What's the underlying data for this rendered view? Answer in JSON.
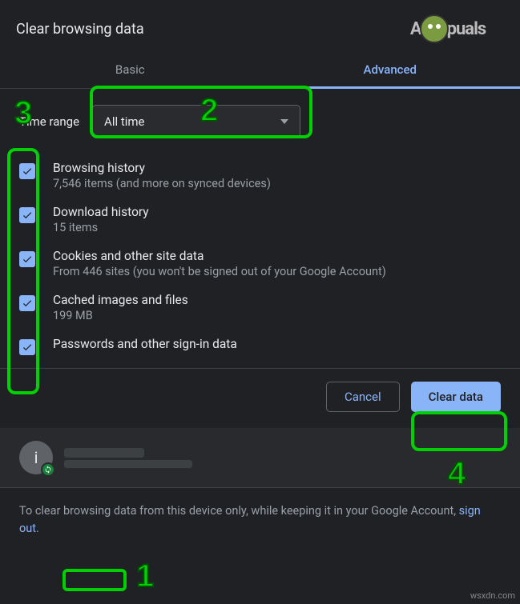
{
  "title": "Clear browsing data",
  "logo_text_left": "A",
  "logo_text_right": "puals",
  "tabs": {
    "basic": "Basic",
    "advanced": "Advanced"
  },
  "time_range_label": "Time range",
  "time_range_value": "All time",
  "items": [
    {
      "title": "Browsing history",
      "sub": "7,546 items (and more on synced devices)"
    },
    {
      "title": "Download history",
      "sub": "15 items"
    },
    {
      "title": "Cookies and other site data",
      "sub": "From 446 sites (you won't be signed out of your Google Account)"
    },
    {
      "title": "Cached images and files",
      "sub": "199 MB"
    },
    {
      "title": "Passwords and other sign-in data",
      "sub": ""
    }
  ],
  "buttons": {
    "cancel": "Cancel",
    "clear": "Clear data"
  },
  "account": {
    "initial": "i"
  },
  "footer": {
    "part1": "To clear browsing data from this device only, while keeping it in your Google Account, ",
    "link": "sign out",
    "part2": "."
  },
  "annotations": {
    "n1": "1",
    "n2": "2",
    "n3": "3",
    "n4": "4"
  },
  "watermark": "wsxdn.com"
}
